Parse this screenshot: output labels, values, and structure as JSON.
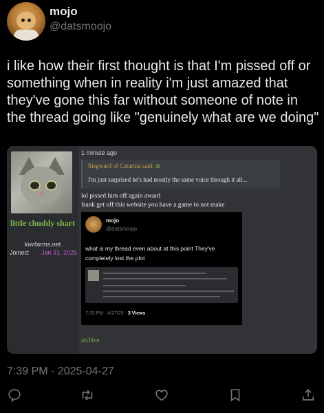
{
  "author": {
    "name": "mojo",
    "handle": "@datsmoojo"
  },
  "tweet": {
    "text": "i like how their first thought is that I'm pissed off or something when in reality i'm just amazed that they've gone this far without someone of note in the thread going like \"genuinely what are we doing\"",
    "timestamp": "7:39 PM · 2025-04-27"
  },
  "screenshot": {
    "poster": {
      "name": "little chuddy shart",
      "site": "kiwifarms.net",
      "joined_label": "Joined:",
      "joined_date": "Jan 31, 2025"
    },
    "post_time": "1 minute ago",
    "quote": {
      "author": "Siegward of Catarina said:",
      "text": "I'm just surprised he's had mostly the same voice through it all..."
    },
    "reply_line1": "lol pissed him off again award",
    "reply_line2": "frank get off this website you have a game to not make",
    "inner_tweet": {
      "name": "mojo",
      "handle": "@datsmoojo",
      "text": "what is my thread even about at this point  They've completely lost the plot",
      "time": "7:33 PM · 4/27/25 · ",
      "views": "3 Views"
    },
    "archive": "archive"
  },
  "icons": [
    "reply-icon",
    "retweet-icon",
    "like-icon",
    "bookmark-icon",
    "share-icon"
  ],
  "colors": {
    "background": "#000000",
    "muted": "#71767b",
    "poster_green": "#7fb94f",
    "joined_purple": "#c45dd0"
  }
}
